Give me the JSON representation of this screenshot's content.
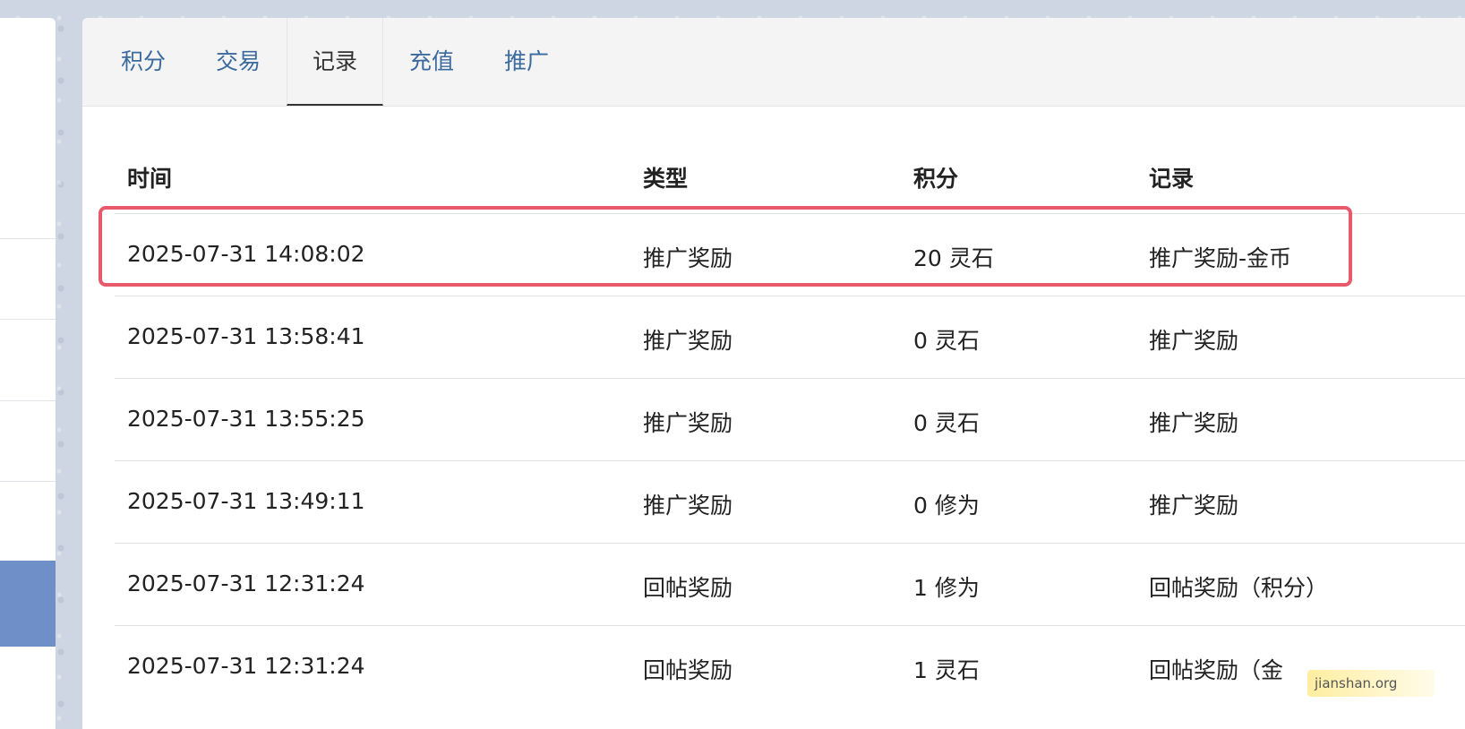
{
  "tabs": [
    {
      "label": "积分"
    },
    {
      "label": "交易"
    },
    {
      "label": "记录",
      "active": true
    },
    {
      "label": "充值"
    },
    {
      "label": "推广"
    }
  ],
  "table": {
    "headers": {
      "time": "时间",
      "type": "类型",
      "points": "积分",
      "record": "记录"
    },
    "rows": [
      {
        "time": "2025-07-31 14:08:02",
        "type": "推广奖励",
        "points": "20 灵石",
        "record": "推广奖励-金币"
      },
      {
        "time": "2025-07-31 13:58:41",
        "type": "推广奖励",
        "points": "0 灵石",
        "record": "推广奖励"
      },
      {
        "time": "2025-07-31 13:55:25",
        "type": "推广奖励",
        "points": "0 灵石",
        "record": "推广奖励"
      },
      {
        "time": "2025-07-31 13:49:11",
        "type": "推广奖励",
        "points": "0 修为",
        "record": "推广奖励"
      },
      {
        "time": "2025-07-31 12:31:24",
        "type": "回帖奖励",
        "points": "1 修为",
        "record": "回帖奖励（积分）"
      },
      {
        "time": "2025-07-31 12:31:24",
        "type": "回帖奖励",
        "points": "1 灵石",
        "record": "回帖奖励（金"
      }
    ]
  },
  "watermark": "jianshan.org",
  "colors": {
    "highlight": "#e85a6b",
    "tab_text": "#3a6a9e",
    "sidebar_active": "#6f8fc9"
  }
}
